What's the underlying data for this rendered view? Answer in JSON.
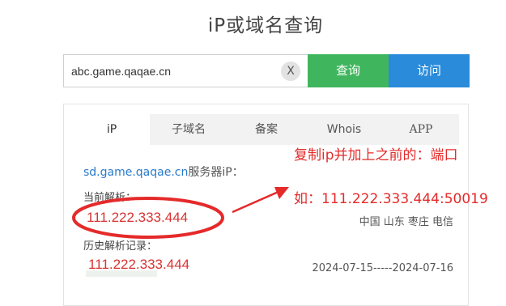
{
  "page": {
    "title": "iP或域名查询"
  },
  "search": {
    "value": "abc.game.qaqae.cn",
    "clear_label": "X",
    "query_label": "查询",
    "visit_label": "访问"
  },
  "tabs": [
    {
      "label": "iP",
      "active": true
    },
    {
      "label": "子域名",
      "active": false
    },
    {
      "label": "备案",
      "active": false
    },
    {
      "label": "Whois",
      "active": false
    },
    {
      "label": "APP",
      "active": false
    }
  ],
  "result": {
    "domain": "sd.game.qaqae.cn",
    "domain_suffix": "服务器iP：",
    "current_label": "当前解析：",
    "current_ip": "111.222.333.444",
    "location": "中国 山东 枣庄 电信",
    "history_label": "历史解析记录：",
    "history_ip": "111.222.333.444",
    "history_range": "2024-07-15-----2024-07-16"
  },
  "annotation": {
    "line1": "复制ip并加上之前的：端口",
    "line2": "如：111.222.333.444:50019",
    "color": "#e52a2a"
  }
}
